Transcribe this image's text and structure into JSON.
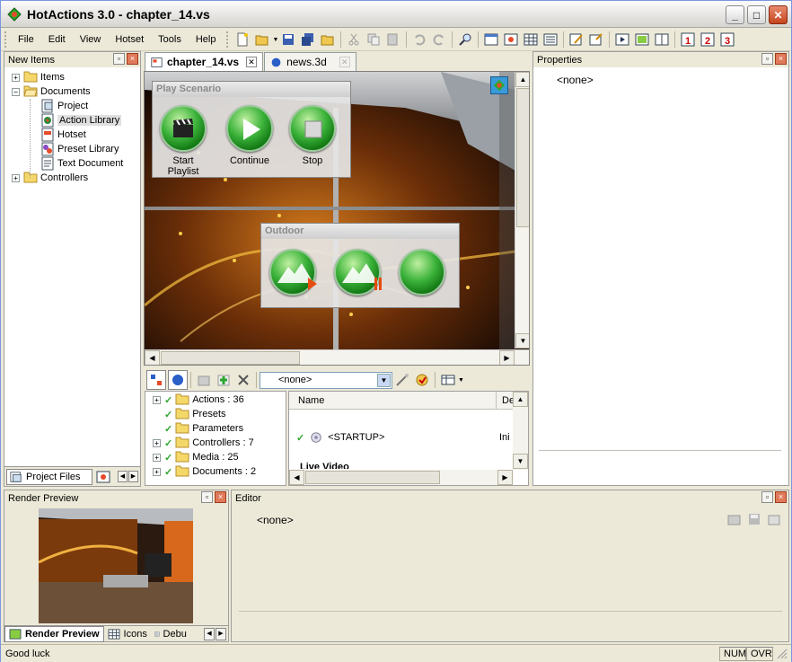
{
  "window": {
    "title": "HotActions 3.0 - chapter_14.vs"
  },
  "menu": [
    "File",
    "Edit",
    "View",
    "Hotset",
    "Tools",
    "Help"
  ],
  "left_panel": {
    "title": "New Items",
    "tree": [
      {
        "label": "Items",
        "level": 0,
        "expander": "+",
        "icon": "folder-icon"
      },
      {
        "label": "Documents",
        "level": 0,
        "expander": "-",
        "icon": "folder-open-icon"
      },
      {
        "label": "Project",
        "level": 1,
        "icon": "project-icon"
      },
      {
        "label": "Action Library",
        "level": 1,
        "icon": "action-library-icon",
        "selected": true
      },
      {
        "label": "Hotset",
        "level": 1,
        "icon": "hotset-icon"
      },
      {
        "label": "Preset Library",
        "level": 1,
        "icon": "preset-library-icon"
      },
      {
        "label": "Text Document",
        "level": 1,
        "icon": "text-document-icon"
      },
      {
        "label": "Controllers",
        "level": 0,
        "expander": "+",
        "icon": "folder-icon"
      }
    ],
    "bottom_tab": "Project Files"
  },
  "doc_tabs": [
    {
      "label": "chapter_14.vs",
      "active": true
    },
    {
      "label": "news.3d",
      "active": false
    }
  ],
  "play_scenario": {
    "title": "Play Scenario",
    "buttons": [
      "Start Playlist",
      "Continue",
      "Stop"
    ]
  },
  "outdoor": {
    "title": "Outdoor"
  },
  "actions_toolbar": {
    "dropdown_value": "<none>"
  },
  "action_tree": [
    {
      "label": "Actions : 36",
      "expander": "+"
    },
    {
      "label": "Presets",
      "expander": ""
    },
    {
      "label": "Parameters",
      "expander": ""
    },
    {
      "label": "Controllers : 7",
      "expander": "+"
    },
    {
      "label": "Media : 25",
      "expander": "+"
    },
    {
      "label": "Documents : 2",
      "expander": "+"
    }
  ],
  "action_list": {
    "columns": [
      "Name",
      "De"
    ],
    "rows": [
      {
        "name": "<STARTUP>",
        "desc": "Ini"
      }
    ],
    "group_label": "Live Video"
  },
  "properties": {
    "title": "Properties",
    "value": "<none>"
  },
  "render_preview": {
    "title": "Render Preview",
    "tabs": [
      "Render Preview",
      "Icons",
      "Debu"
    ]
  },
  "editor": {
    "title": "Editor",
    "value": "<none>"
  },
  "status": {
    "text": "Good luck",
    "cells": [
      "NUM",
      "OVR"
    ]
  },
  "colors": {
    "accent_green": "#2ea62e",
    "title_bg": "#e4e3e0",
    "panel_bg": "#ece9d8"
  }
}
